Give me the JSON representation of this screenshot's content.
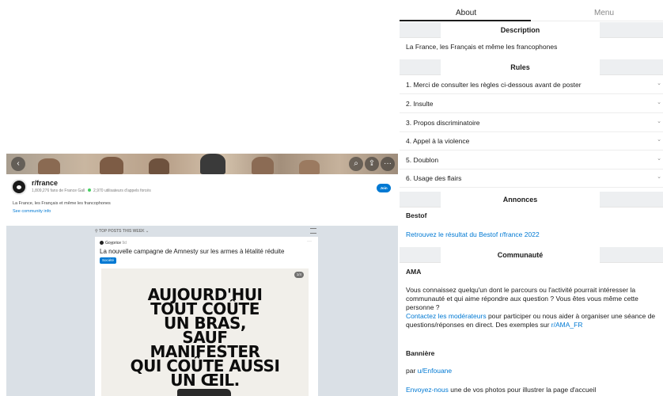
{
  "subreddit": {
    "name": "r/france",
    "stats": "1,809,276 fans de France Gall",
    "online": "2,970 utilisateurs d'appels forcés",
    "description": "La France, les Français et même les francophones",
    "community_info": "See community info",
    "join_label": "Join"
  },
  "feed": {
    "sort_label": "TOP POSTS THIS WEEK",
    "post": {
      "author": "Goyprice",
      "age": "9d",
      "title": "La nouvelle campagne de Amnesty sur les armes à létalité réduite",
      "flair": "Société",
      "media_count": "1/4",
      "poster_lines": [
        "AUJOURD'HUI",
        "TOUT COÛTE",
        "UN BRAS,",
        "SAUF",
        "MANIFESTER",
        "QUI COÛTE AUSSI",
        "UN ŒIL."
      ]
    }
  },
  "sidebar": {
    "tabs": [
      "About",
      "Menu"
    ],
    "description_header": "Description",
    "description_text": "La France, les Français et même les francophones",
    "rules_header": "Rules",
    "rules": [
      "1. Merci de consulter les règles ci-dessous avant de poster",
      "2. Insulte",
      "3. Propos discriminatoire",
      "4. Appel à la violence",
      "5. Doublon",
      "6. Usage des flairs"
    ],
    "annonces_header": "Annonces",
    "bestof_title": "Bestof",
    "bestof_link": "Retrouvez le résultat du Bestof r/france 2022",
    "communaute_header": "Communauté",
    "ama_title": "AMA",
    "ama_text": "Vous connaissez quelqu'un dont le parcours ou l'activité pourrait intéresser la communauté et qui aime répondre aux question ? Vous êtes vous même cette personne ?",
    "ama_contact_link": "Contactez les modérateurs",
    "ama_contact_rest": " pour participer ou nous aider à organiser une séance de questions/réponses en direct. Des exemples sur ",
    "ama_examples_link": "r/AMA_FR",
    "banniere_title": "Bannière",
    "banniere_by": "par ",
    "banniere_user": "u/Enfouane",
    "banniere_send_link": "Envoyez-nous",
    "banniere_send_rest": " une de vos photos pour illustrer la page d'accueil"
  },
  "colors": {
    "accent": "#0079d3",
    "online_dot": "#46d160"
  },
  "icons": [
    "back-icon",
    "search-icon",
    "share-icon",
    "more-icon",
    "chevron-down-icon"
  ]
}
